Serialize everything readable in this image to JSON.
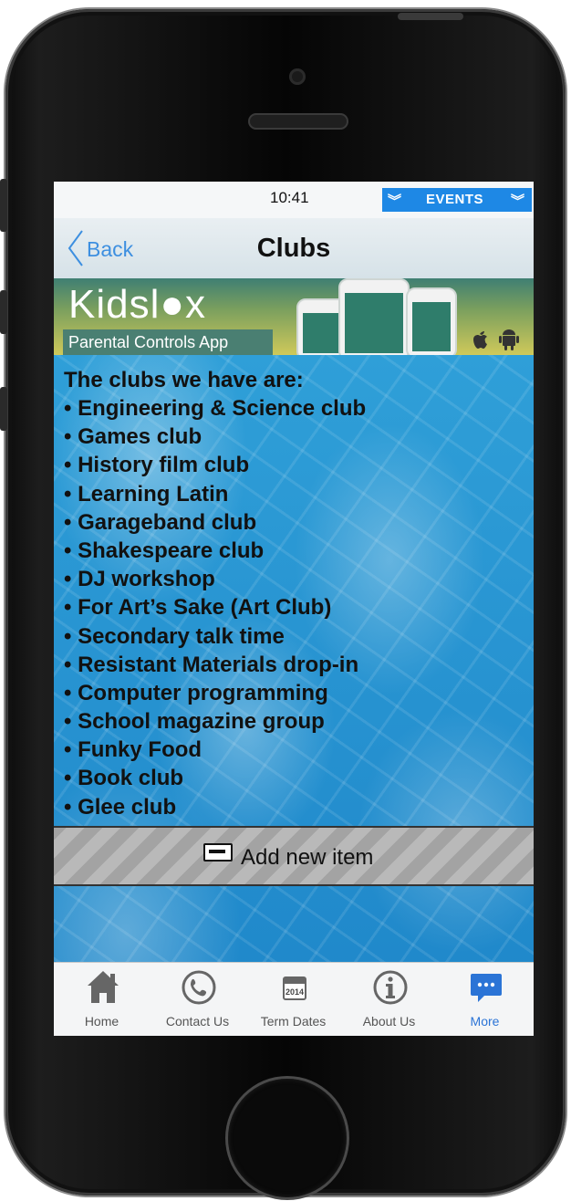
{
  "status_bar": {
    "time": "10:41"
  },
  "events_pill": {
    "label": "EVENTS",
    "chevron_icon": "double-chevron-down-icon",
    "color": "#1e88e5"
  },
  "nav": {
    "back_label": "Back",
    "title": "Clubs",
    "accent": "#3d8fe0"
  },
  "banner": {
    "brand": "Kidsl●x",
    "tagline": "Parental Controls App",
    "platform_icons": [
      "apple-icon",
      "android-icon"
    ]
  },
  "content": {
    "intro": "The clubs we have are:",
    "clubs": [
      "• Engineering & Science club",
      "• Games club",
      "• History film club",
      "• Learning Latin",
      "• Garageband club",
      "• Shakespeare club",
      "• DJ workshop",
      "• For Art’s Sake (Art Club)",
      "• Secondary talk time",
      "• Resistant Materials drop-in",
      "• Computer programming",
      "• School magazine group",
      "• Funky Food",
      "• Book club",
      "• Glee club"
    ],
    "add_item_label": "Add new item"
  },
  "tabs": [
    {
      "label": "Home",
      "icon": "home-icon",
      "active": false
    },
    {
      "label": "Contact Us",
      "icon": "phone-icon",
      "active": false
    },
    {
      "label": "Term Dates",
      "icon": "calendar-icon",
      "active": false,
      "icon_text": "2014"
    },
    {
      "label": "About Us",
      "icon": "info-icon",
      "active": false
    },
    {
      "label": "More",
      "icon": "chat-bubble-icon",
      "active": true
    }
  ],
  "colors": {
    "active_tab": "#2b74d6",
    "tab_inactive": "#555555"
  }
}
